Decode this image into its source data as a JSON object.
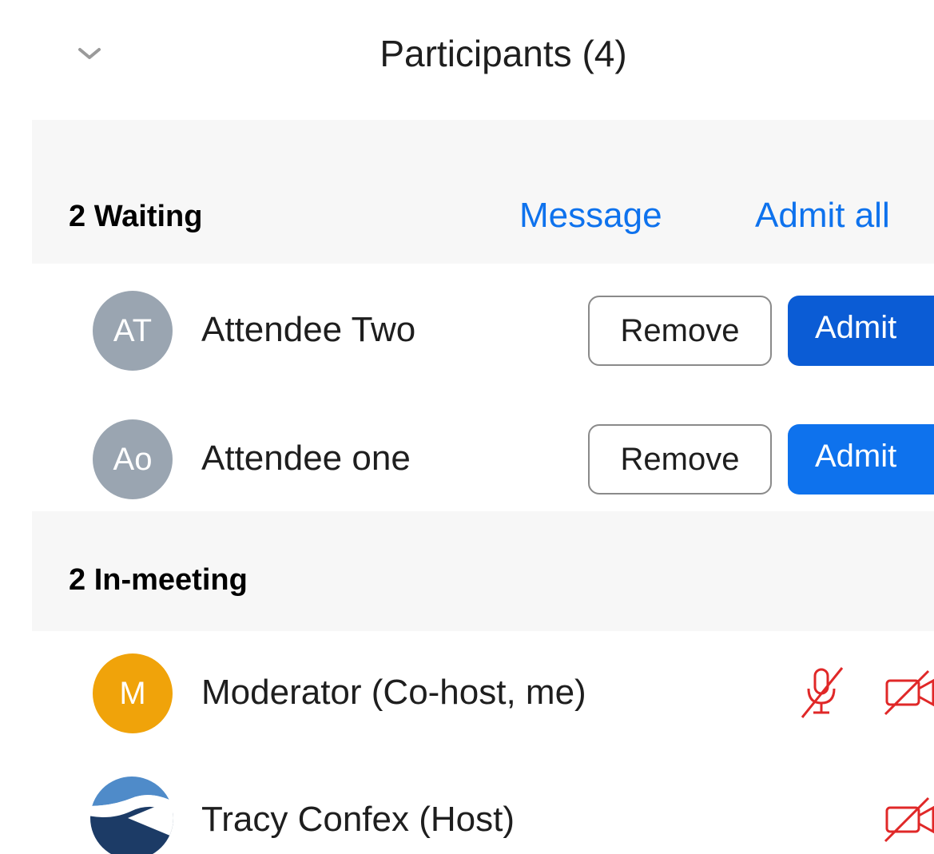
{
  "panel": {
    "title": "Participants (4)"
  },
  "waiting": {
    "title": "2 Waiting",
    "message_label": "Message",
    "admit_all_label": "Admit all",
    "participants": [
      {
        "initials": "AT",
        "name": "Attendee Two",
        "remove_label": "Remove",
        "admit_label": "Admit"
      },
      {
        "initials": "Ao",
        "name": "Attendee one",
        "remove_label": "Remove",
        "admit_label": "Admit"
      }
    ]
  },
  "in_meeting": {
    "title": "2 In-meeting",
    "participants": [
      {
        "initials": "M",
        "name": "Moderator (Co-host, me)",
        "mic_icon": "mic-muted-icon",
        "video_icon": "video-off-icon"
      },
      {
        "name": "Tracy Confex (Host)",
        "video_icon": "video-off-icon"
      }
    ]
  },
  "colors": {
    "link_blue": "#0e72ed",
    "admit_blue_dark": "#0b5cd5",
    "admit_blue": "#0e72ed",
    "avatar_gray": "#9aa5b1",
    "avatar_orange": "#f0a30a",
    "muted_red": "#e02828"
  }
}
